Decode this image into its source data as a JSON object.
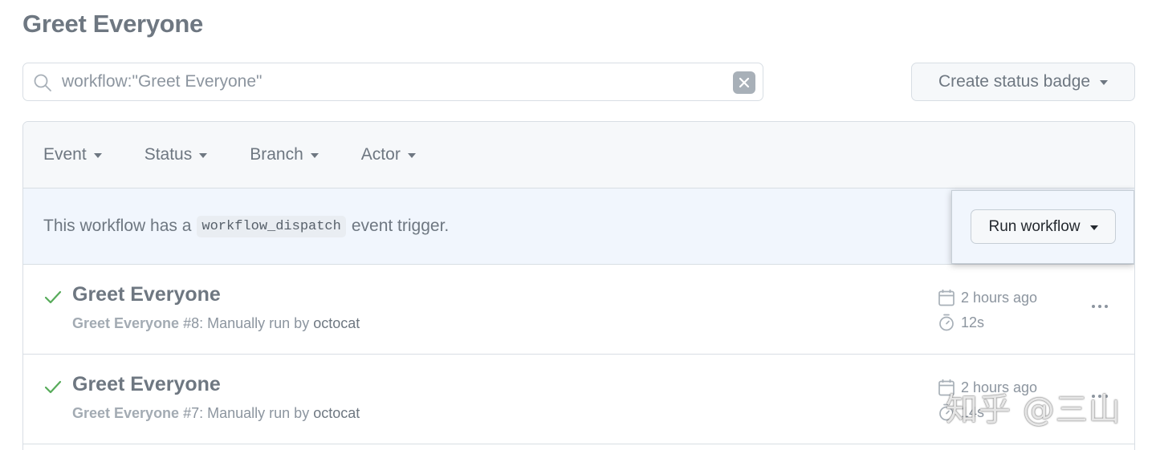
{
  "page": {
    "title": "Greet Everyone"
  },
  "search": {
    "value": "workflow:\"Greet Everyone\""
  },
  "badge_button": {
    "label": "Create status badge"
  },
  "filters": [
    {
      "label": "Event"
    },
    {
      "label": "Status"
    },
    {
      "label": "Branch"
    },
    {
      "label": "Actor"
    }
  ],
  "dispatch": {
    "text_before": "This workflow has a",
    "code": "workflow_dispatch",
    "text_after": "event trigger.",
    "run_button_label": "Run workflow"
  },
  "runs": [
    {
      "title": "Greet Everyone",
      "workflow": "Greet Everyone",
      "number": "#8",
      "description": ": Manually run by",
      "actor": "octocat",
      "time": "2 hours ago",
      "duration": "12s",
      "status": "success"
    },
    {
      "title": "Greet Everyone",
      "workflow": "Greet Everyone",
      "number": "#7",
      "description": ": Manually run by",
      "actor": "octocat",
      "time": "2 hours ago",
      "duration": "14s",
      "status": "success"
    }
  ],
  "watermark": {
    "text": "知乎 @三山"
  },
  "colors": {
    "success": "#57ab5a",
    "muted": "#6e7781",
    "border": "#d8dee4",
    "dispatch_bg": "#f1f6fd"
  },
  "icons": {
    "search": "search-icon",
    "clear": "x-circle-fill-icon",
    "caret": "triangle-down-icon",
    "check": "check-icon",
    "calendar": "calendar-icon",
    "stopwatch": "stopwatch-icon",
    "more": "kebab-horizontal-icon"
  }
}
